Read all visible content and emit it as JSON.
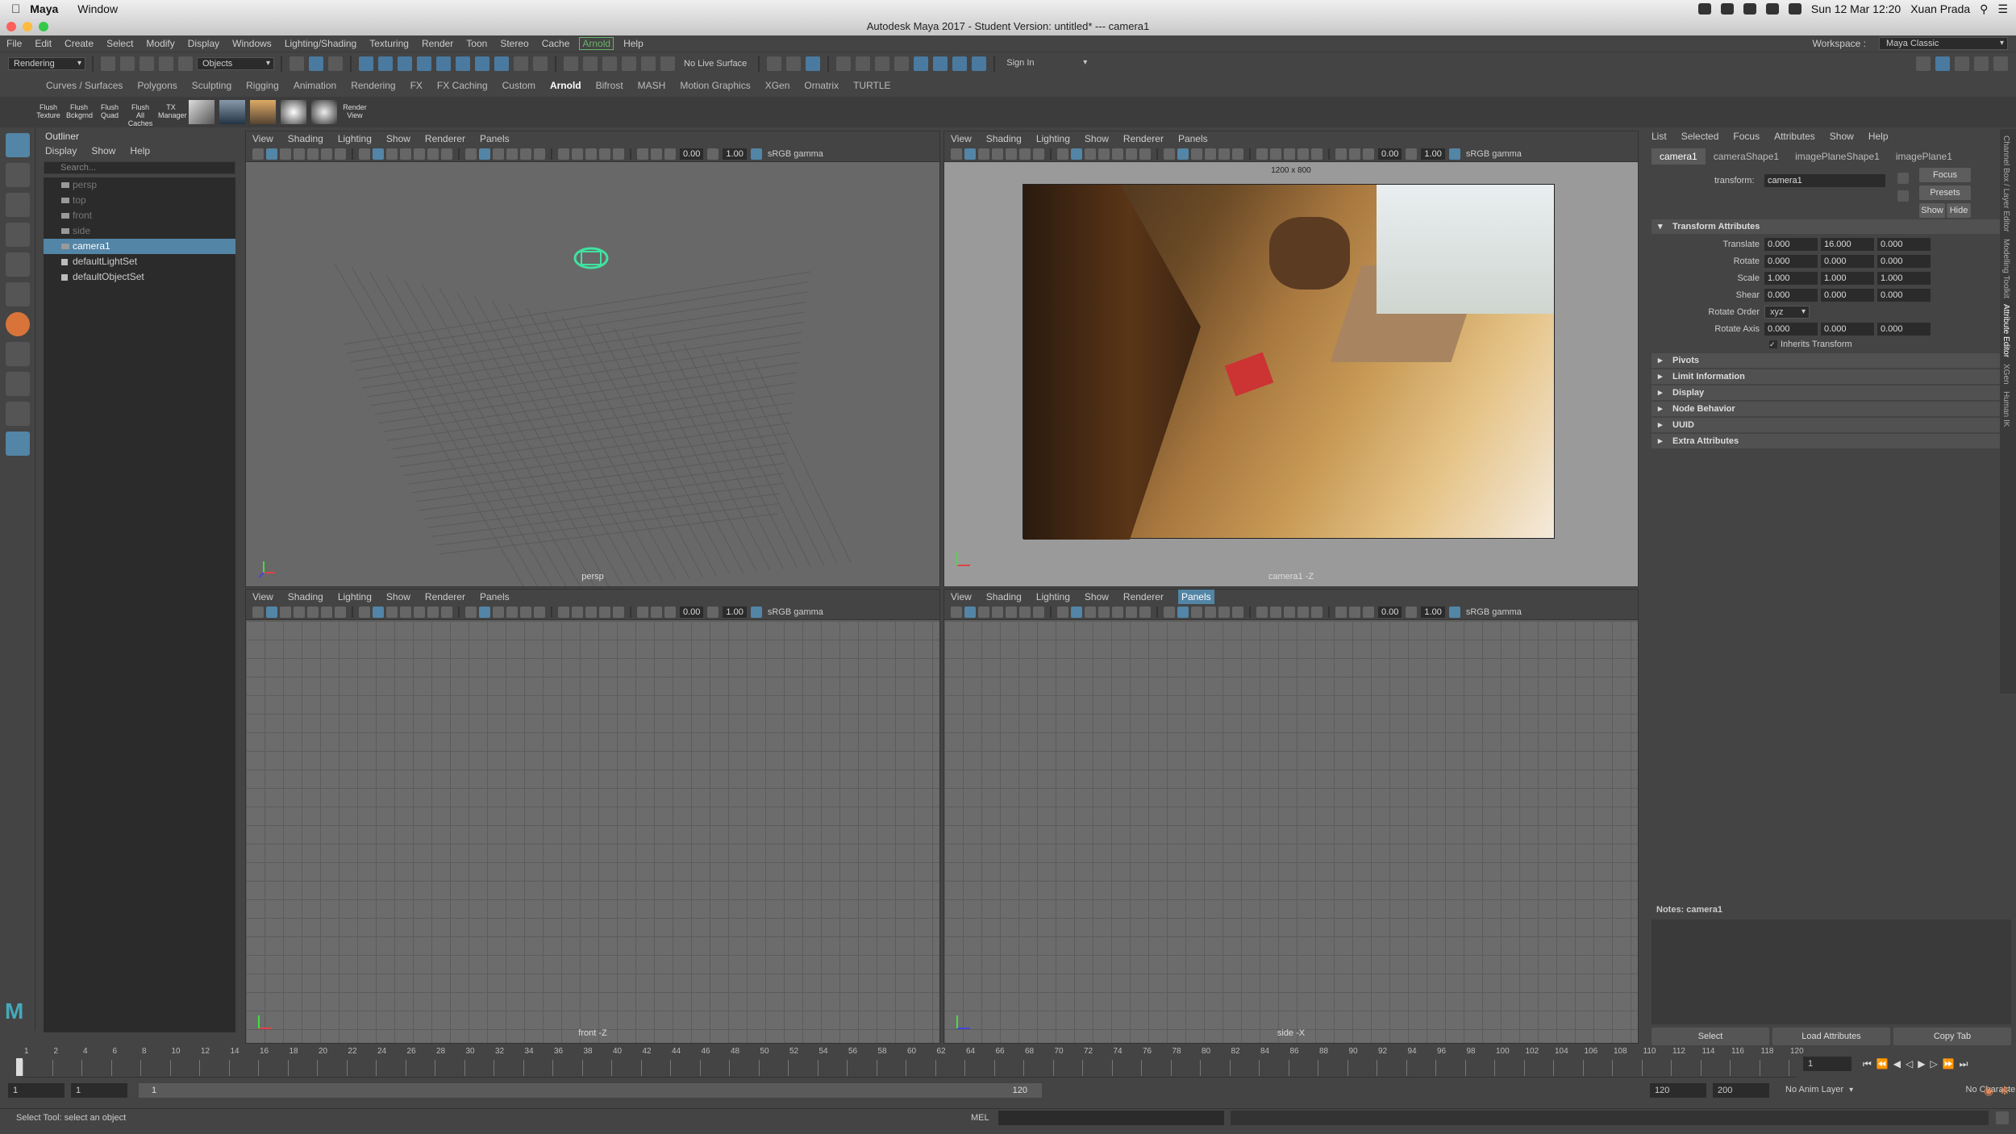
{
  "mac": {
    "app": "Maya",
    "menu": [
      "Window"
    ],
    "datetime": "Sun 12 Mar  12:20",
    "user": "Xuan Prada"
  },
  "window_title": "Autodesk Maya 2017 - Student Version: untitled*   ---   camera1",
  "menubar": {
    "items": [
      "File",
      "Edit",
      "Create",
      "Select",
      "Modify",
      "Display",
      "Windows",
      "Lighting/Shading",
      "Texturing",
      "Render",
      "Toon",
      "Stereo",
      "Cache"
    ],
    "arnold": "Arnold",
    "help": "Help",
    "workspace_label": "Workspace :",
    "workspace_value": "Maya Classic"
  },
  "statusline": {
    "mode": "Rendering",
    "objects": "Objects",
    "live_surface": "No Live Surface",
    "sign_in": "Sign In"
  },
  "shelf": {
    "tabs": [
      "Curves / Surfaces",
      "Polygons",
      "Sculpting",
      "Rigging",
      "Animation",
      "Rendering",
      "FX",
      "FX Caching",
      "Custom",
      "Arnold",
      "Bifrost",
      "MASH",
      "Motion Graphics",
      "XGen",
      "Ornatrix",
      "TURTLE"
    ],
    "active": "Arnold",
    "icons": [
      "Flush Texture",
      "Flush Bckgrnd",
      "Flush Quad",
      "Flush All Caches",
      "TX Manager",
      "",
      "",
      "",
      "",
      "",
      "Render View"
    ]
  },
  "outliner": {
    "title": "Outliner",
    "menu": [
      "Display",
      "Show",
      "Help"
    ],
    "search_placeholder": "Search...",
    "items": [
      {
        "label": "persp",
        "dim": true
      },
      {
        "label": "top",
        "dim": true
      },
      {
        "label": "front",
        "dim": true
      },
      {
        "label": "side",
        "dim": true
      },
      {
        "label": "camera1",
        "selected": true
      },
      {
        "label": "defaultLightSet"
      },
      {
        "label": "defaultObjectSet"
      }
    ]
  },
  "viewports": [
    {
      "menu": [
        "View",
        "Shading",
        "Lighting",
        "Show",
        "Renderer",
        "Panels"
      ],
      "v1": "0.00",
      "v2": "1.00",
      "gamma": "sRGB gamma",
      "label": "persp"
    },
    {
      "menu": [
        "View",
        "Shading",
        "Lighting",
        "Show",
        "Renderer",
        "Panels"
      ],
      "v1": "0.00",
      "v2": "1.00",
      "gamma": "sRGB gamma",
      "label": "camera1 -Z",
      "resolution": "1200 x 800"
    },
    {
      "menu": [
        "View",
        "Shading",
        "Lighting",
        "Show",
        "Renderer",
        "Panels"
      ],
      "v1": "0.00",
      "v2": "1.00",
      "gamma": "sRGB gamma",
      "label": "front -Z"
    },
    {
      "menu": [
        "View",
        "Shading",
        "Lighting",
        "Show",
        "Renderer",
        "Panels"
      ],
      "v1": "0.00",
      "v2": "1.00",
      "gamma": "sRGB gamma",
      "label": "side -X"
    }
  ],
  "attr": {
    "menu": [
      "List",
      "Selected",
      "Focus",
      "Attributes",
      "Show",
      "Help"
    ],
    "tabs": [
      "camera1",
      "cameraShape1",
      "imagePlaneShape1",
      "imagePlane1"
    ],
    "transform_label": "transform:",
    "transform_value": "camera1",
    "focus": "Focus",
    "presets": "Presets",
    "show": "Show",
    "hide": "Hide",
    "section": "Transform Attributes",
    "rows": [
      {
        "label": "Translate",
        "v": [
          "0.000",
          "16.000",
          "0.000"
        ]
      },
      {
        "label": "Rotate",
        "v": [
          "0.000",
          "0.000",
          "0.000"
        ]
      },
      {
        "label": "Scale",
        "v": [
          "1.000",
          "1.000",
          "1.000"
        ]
      },
      {
        "label": "Shear",
        "v": [
          "0.000",
          "0.000",
          "0.000"
        ]
      }
    ],
    "rotate_order_label": "Rotate Order",
    "rotate_order": "xyz",
    "rotate_axis": {
      "label": "Rotate Axis",
      "v": [
        "0.000",
        "0.000",
        "0.000"
      ]
    },
    "inherits": "Inherits Transform",
    "sections": [
      "Pivots",
      "Limit Information",
      "Display",
      "Node Behavior",
      "UUID",
      "Extra Attributes"
    ],
    "notes": "Notes:  camera1",
    "btn_select": "Select",
    "btn_load": "Load Attributes",
    "btn_copy": "Copy Tab"
  },
  "side_tabs": [
    "Channel Box / Layer Editor",
    "Modelling Toolkit",
    "Attribute Editor",
    "XGen",
    "Human IK"
  ],
  "timeline": {
    "ticks": [
      "1",
      "2",
      "4",
      "6",
      "8",
      "10",
      "12",
      "14",
      "16",
      "18",
      "20",
      "22",
      "24",
      "26",
      "28",
      "30",
      "32",
      "34",
      "36",
      "38",
      "40",
      "42",
      "44",
      "46",
      "48",
      "50",
      "52",
      "54",
      "56",
      "58",
      "60",
      "62",
      "64",
      "66",
      "68",
      "70",
      "72",
      "74",
      "76",
      "78",
      "80",
      "82",
      "84",
      "86",
      "88",
      "90",
      "92",
      "94",
      "96",
      "98",
      "100",
      "102",
      "104",
      "106",
      "108",
      "110",
      "112",
      "114",
      "116",
      "118",
      "120"
    ],
    "current": "1"
  },
  "range": {
    "start": "1",
    "start2": "1",
    "slider_start": "1",
    "slider_end": "120",
    "end": "120",
    "end2": "200",
    "anim_layer": "No Anim Layer",
    "char_set": "No Character Set"
  },
  "cmd": {
    "help": "Select Tool: select an object",
    "lang": "MEL"
  },
  "colors": {
    "selection": "#5285a6",
    "panel": "#444444",
    "viewport": "#686868"
  }
}
